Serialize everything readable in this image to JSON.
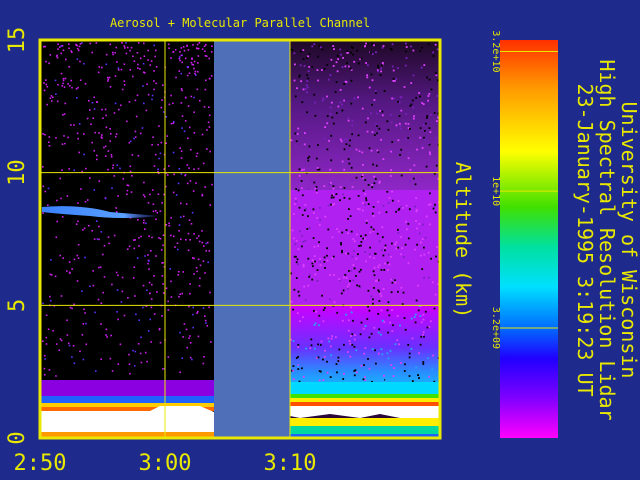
{
  "title": "Aerosol + Molecular Parallel Channel",
  "side_text": {
    "line1": "University of Wisconsin",
    "line2": "High Spectral Resolution Lidar",
    "line3": "23-January-1995    3:19:23 UT"
  },
  "colors": {
    "background": "#1e2a8c",
    "frame": "#e8e800",
    "gap": "#4f70b8",
    "labels": "#e8e800"
  },
  "colorbar": {
    "ticks": [
      {
        "label": "3.2e+10",
        "value": 32000000000
      },
      {
        "label": "1e+10",
        "value": 10000000000
      },
      {
        "label": "3.2e+09",
        "value": 3200000000
      }
    ],
    "scale": "log"
  },
  "chart_data": {
    "type": "heatmap",
    "title": "Aerosol + Molecular Parallel Channel",
    "xlabel": "",
    "ylabel": "Altitude (km)",
    "xticks": [
      "2:50",
      "3:00",
      "3:10"
    ],
    "yticks": [
      0,
      5,
      10,
      15
    ],
    "xlim": [
      "2:50",
      "3:22"
    ],
    "ylim": [
      0,
      15
    ],
    "grid": true,
    "no_data_interval": [
      "3:03",
      "3:09"
    ],
    "features": [
      {
        "name": "boundary layer",
        "altitude_top_km": 1.3
      },
      {
        "name": "thin cloud layer",
        "altitude_km": 8.5,
        "time_range": [
          "2:50",
          "2:58"
        ]
      }
    ]
  }
}
